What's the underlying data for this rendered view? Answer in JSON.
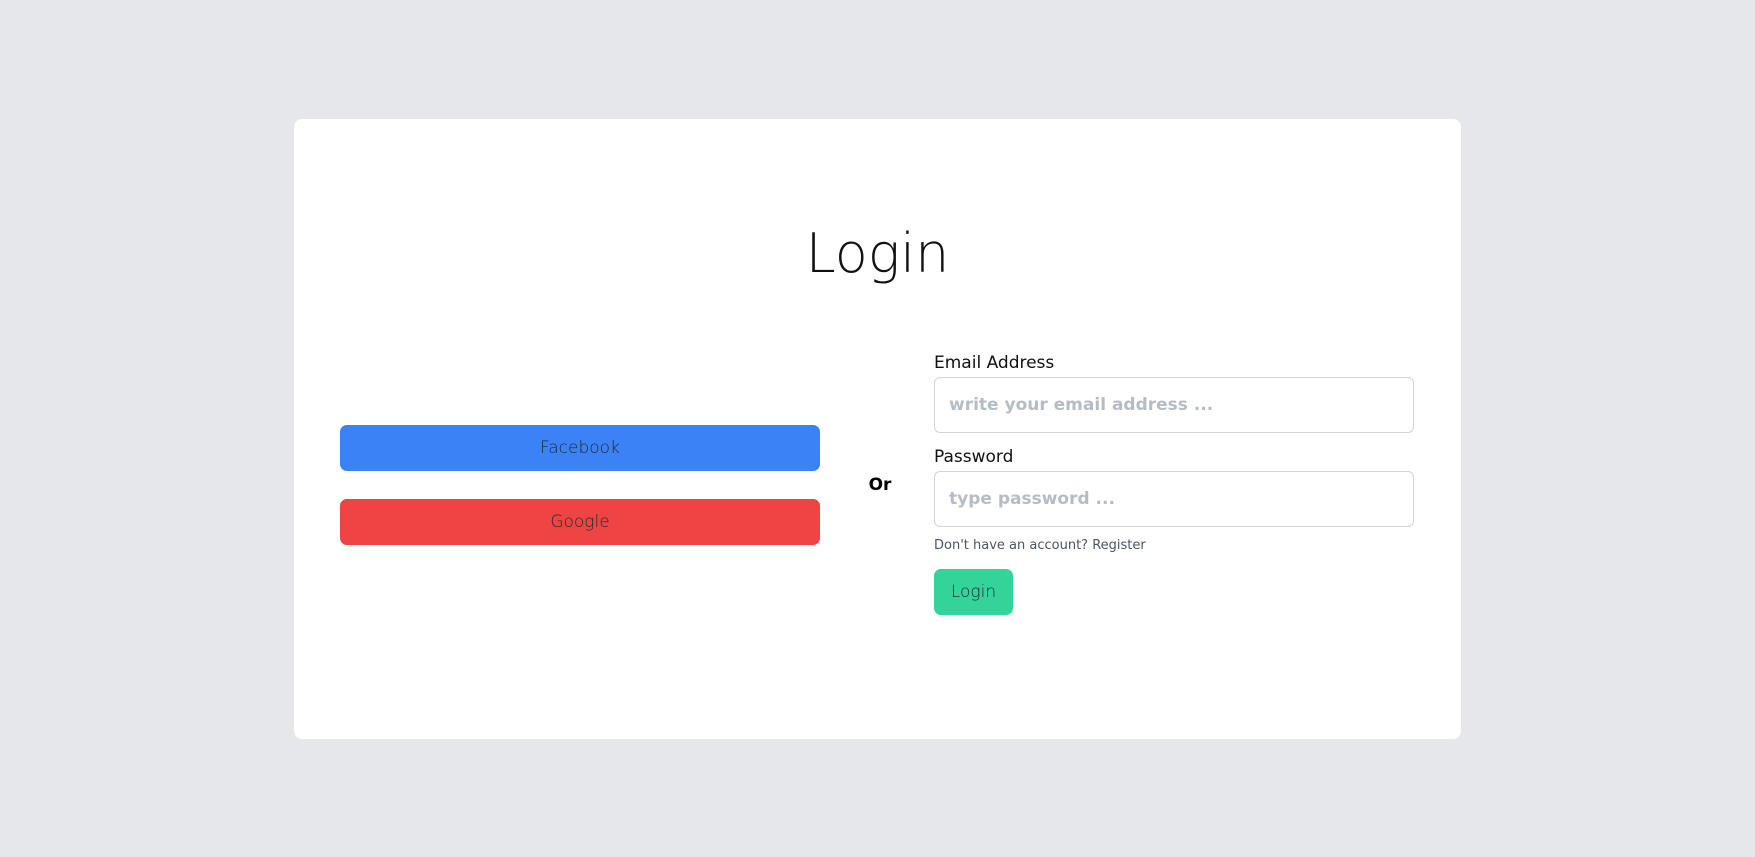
{
  "page": {
    "title": "Login",
    "colors": {
      "background": "#e5e7eb",
      "card": "#ffffff",
      "facebook": "#3b82f6",
      "google": "#ef4444",
      "login": "#34d399"
    }
  },
  "social": {
    "facebook_label": "Facebook",
    "google_label": "Google"
  },
  "divider": {
    "label": "Or"
  },
  "form": {
    "email_label": "Email Address",
    "email_value": "",
    "email_placeholder": "write your email address ...",
    "password_label": "Password",
    "password_value": "",
    "password_placeholder": "type password ...",
    "register_prompt": "Don't have an account?",
    "register_link": "Register",
    "login_label": "Login"
  }
}
